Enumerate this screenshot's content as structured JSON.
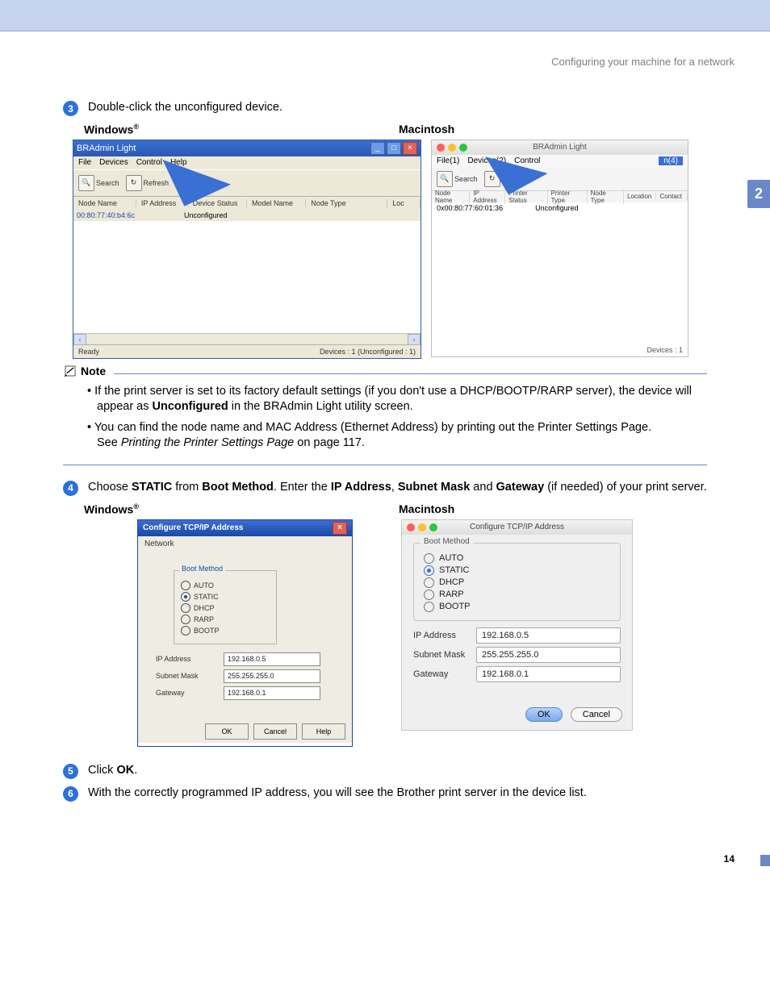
{
  "header": {
    "title": "Configuring your machine for a network"
  },
  "side_tab": "2",
  "page_number": "14",
  "steps": {
    "s3": {
      "num": "3",
      "text": "Double-click the unconfigured device."
    },
    "s4": {
      "num": "4",
      "pre": "Choose ",
      "b1": "STATIC",
      "mid1": " from ",
      "b2": "Boot Method",
      "mid2": ". Enter the ",
      "b3": "IP Address",
      "mid3": ", ",
      "b4": "Subnet Mask",
      "mid4": " and ",
      "b5": "Gateway",
      "post": " (if needed) of your print server."
    },
    "s5": {
      "num": "5",
      "pre": "Click ",
      "b1": "OK",
      "post": "."
    },
    "s6": {
      "num": "6",
      "text": "With the correctly programmed IP address, you will see the Brother print server in the device list."
    }
  },
  "labels": {
    "windows_r": "Windows",
    "reg": "®",
    "macintosh": "Macintosh"
  },
  "note": {
    "label": "Note",
    "li1a": "If the print server is set to its factory default settings (if you don't use a DHCP/BOOTP/RARP server), the device will appear as ",
    "li1b": "Unconfigured",
    "li1c": " in the BRAdmin Light utility screen.",
    "li2a": "You can find the node name and MAC Address (Ethernet Address) by printing out the Printer Settings Page.",
    "li2b": "See ",
    "li2c": "Printing the Printer Settings Page",
    "li2d": " on page 117."
  },
  "win_bradmin": {
    "title": "BRAdmin Light",
    "menu": {
      "file": "File",
      "devices": "Devices",
      "control": "Control",
      "help": "Help"
    },
    "tool": {
      "search": "Search",
      "refresh": "Refresh"
    },
    "cols": {
      "c1": "Node Name",
      "c2": "IP Address",
      "c3": "Device Status",
      "c4": "Model Name",
      "c5": "Node Type",
      "c6": "Loc"
    },
    "row": {
      "mac": "00:80:77:40:b4:6c",
      "status": "Unconfigured"
    },
    "status_left": "Ready",
    "status_right": "Devices : 1  (Unconfigured : 1)"
  },
  "mac_bradmin": {
    "title": "BRAdmin Light",
    "menu": {
      "file": "File(1)",
      "devices": "Devices(2)",
      "control": "Control",
      "n": "n(4)"
    },
    "tool": {
      "search": "Search",
      "re": "Re"
    },
    "cols": {
      "c0": "Node Name",
      "c1": "IP Address",
      "c2": "Printer Status",
      "c3": "Printer Type",
      "c4": "Node Type",
      "c5": "Location",
      "c6": "Contact"
    },
    "row": {
      "mac": "0x00:80:77:60:01:36",
      "status": "Unconfigured"
    },
    "status": "Devices : 1"
  },
  "tcp_win": {
    "title": "Configure TCP/IP Address",
    "tab": "Network",
    "group": "Boot Method",
    "opts": {
      "auto": "AUTO",
      "static": "STATIC",
      "dhcp": "DHCP",
      "rarp": "RARP",
      "bootp": "BOOTP"
    },
    "fields": {
      "ip_l": "IP Address",
      "ip_v": "192.168.0.5",
      "sm_l": "Subnet Mask",
      "sm_v": "255.255.255.0",
      "gw_l": "Gateway",
      "gw_v": "192.168.0.1"
    },
    "btns": {
      "ok": "OK",
      "cancel": "Cancel",
      "help": "Help"
    }
  },
  "tcp_mac": {
    "title": "Configure TCP/IP Address",
    "group": "Boot Method",
    "opts": {
      "auto": "AUTO",
      "static": "STATIC",
      "dhcp": "DHCP",
      "rarp": "RARP",
      "bootp": "BOOTP"
    },
    "fields": {
      "ip_l": "IP Address",
      "ip_v": "192.168.0.5",
      "sm_l": "Subnet Mask",
      "sm_v": "255.255.255.0",
      "gw_l": "Gateway",
      "gw_v": "192.168.0.1"
    },
    "btns": {
      "ok": "OK",
      "cancel": "Cancel"
    }
  }
}
